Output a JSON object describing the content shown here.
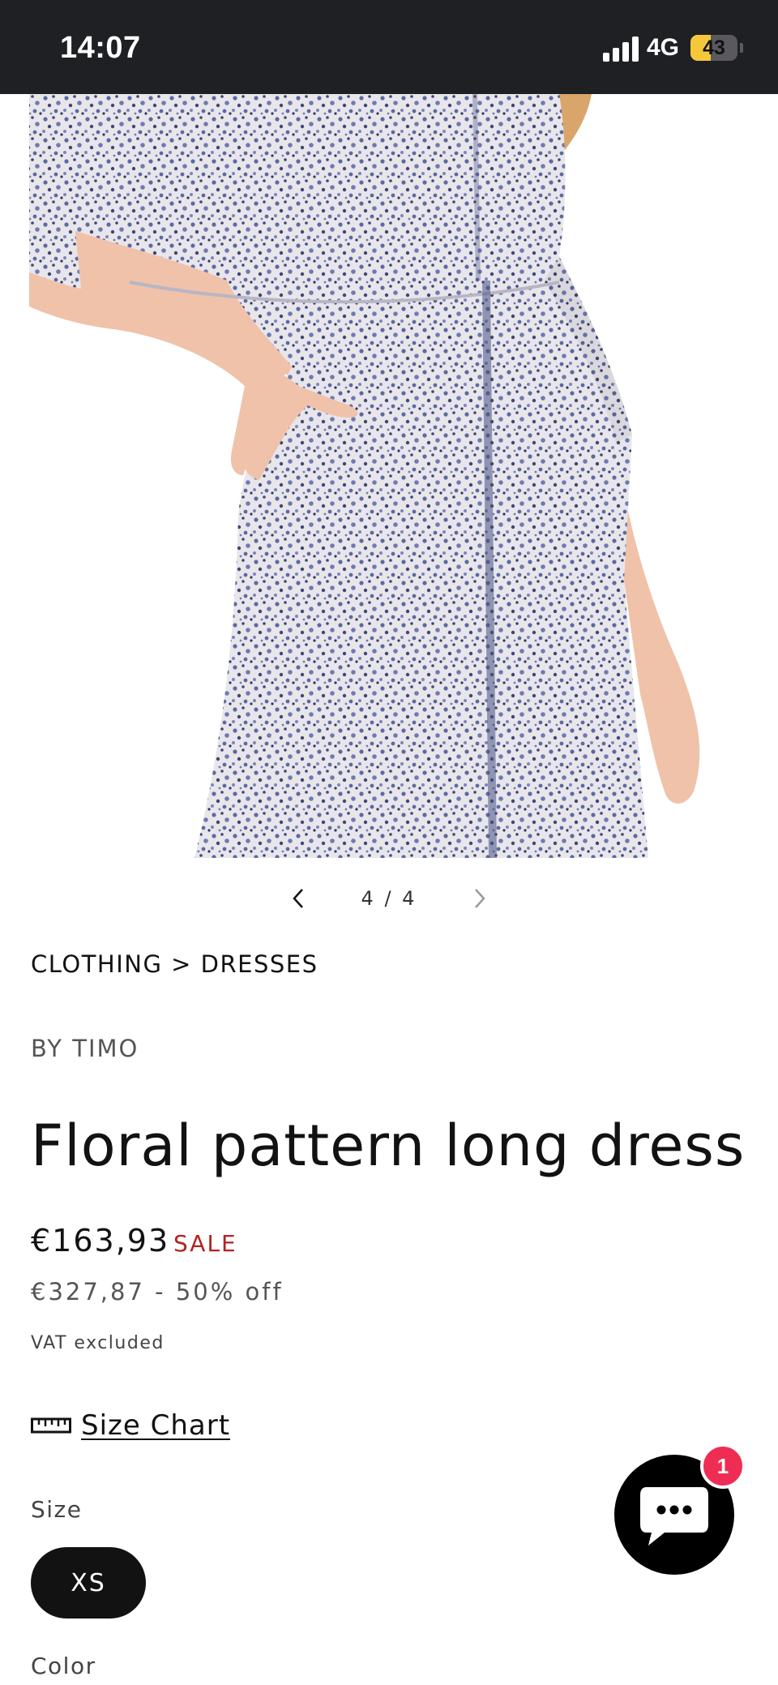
{
  "status_bar": {
    "time": "14:07",
    "network": "4G",
    "battery_percent": "43",
    "battery_level": 0.43
  },
  "gallery": {
    "counter": "4 / 4",
    "prev_icon": "chevron-left-icon",
    "next_icon": "chevron-right-icon"
  },
  "product": {
    "breadcrumb": "CLOTHING > DRESSES",
    "vendor": "BY TIMO",
    "title": "Floral pattern long dress",
    "price": "€163,93",
    "sale_badge": "SALE",
    "compare_price": "€327,87 - 50% off",
    "tax_note": "VAT excluded",
    "size_chart_label": "Size Chart",
    "size_chart_icon": "ruler-icon",
    "size_label": "Size",
    "selected_size": "XS",
    "color_label": "Color"
  },
  "chat": {
    "icon": "chat-bubble-icon",
    "unread_count": "1"
  },
  "colors": {
    "status_bar_bg": "#1f2024",
    "battery": "#f5c83a",
    "sale_red": "#b1231f",
    "chat_badge": "#ef2d54",
    "dress_base": "#e8e6ea",
    "dress_print": "#5b6aa3",
    "skin": "#f0c2aa"
  }
}
